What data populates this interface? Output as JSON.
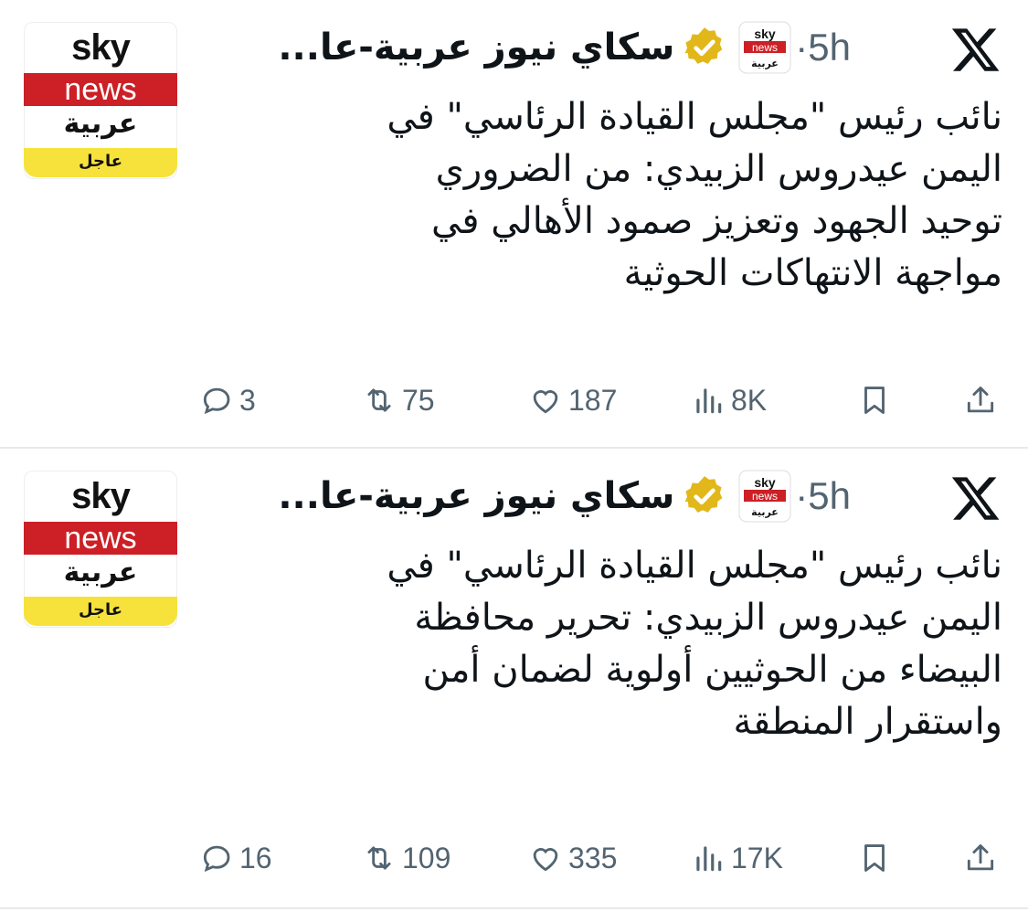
{
  "tweets": [
    {
      "account_name": "سكاي نيوز عربية-عا...",
      "time": "·5h",
      "avatar": {
        "line1": "sky",
        "line2": "news",
        "line3": "عربية",
        "tag": "عاجل"
      },
      "mini_logo": {
        "line1": "sky",
        "line2": "news",
        "line3": "عربية"
      },
      "text": "نائب رئيس \"مجلس القيادة الرئاسي\" في\nاليمن عيدروس الزبيدي: من الضروري\nتوحيد الجهود وتعزيز صمود الأهالي في\nمواجهة الانتهاكات الحوثية",
      "stats": {
        "replies": "3",
        "retweets": "75",
        "likes": "187",
        "views": "8K"
      }
    },
    {
      "account_name": "سكاي نيوز عربية-عا...",
      "time": "·5h",
      "avatar": {
        "line1": "sky",
        "line2": "news",
        "line3": "عربية",
        "tag": "عاجل"
      },
      "mini_logo": {
        "line1": "sky",
        "line2": "news",
        "line3": "عربية"
      },
      "text": "نائب رئيس \"مجلس القيادة الرئاسي\" في\nاليمن عيدروس الزبيدي: تحرير محافظة\nالبيضاء من الحوثيين أولوية لضمان أمن\nواستقرار المنطقة",
      "stats": {
        "replies": "16",
        "retweets": "109",
        "likes": "335",
        "views": "17K"
      }
    }
  ],
  "icons": {
    "platform": "x-logo-icon",
    "verified": "verified-badge-icon",
    "reply": "reply-icon",
    "retweet": "retweet-icon",
    "like": "heart-icon",
    "views": "views-icon",
    "bookmark": "bookmark-icon",
    "share": "share-icon"
  },
  "colors": {
    "brand_red": "#cc1f26",
    "brand_yellow": "#f7e23c",
    "verified_gold": "#e2b719",
    "muted": "#536471"
  }
}
